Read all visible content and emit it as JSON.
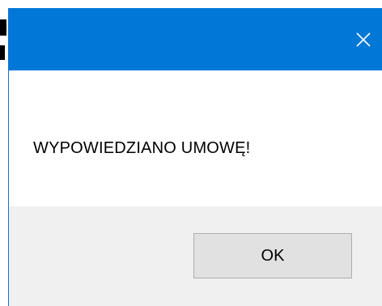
{
  "dialog": {
    "title": "",
    "message": "WYPOWIEDZIANO UMOWĘ!",
    "close_icon": "close-icon",
    "ok_label": "OK"
  },
  "colors": {
    "titlebar": "#0078d7",
    "footer": "#f0f0f0",
    "button": "#e1e1e1",
    "button_border": "#adadad"
  }
}
